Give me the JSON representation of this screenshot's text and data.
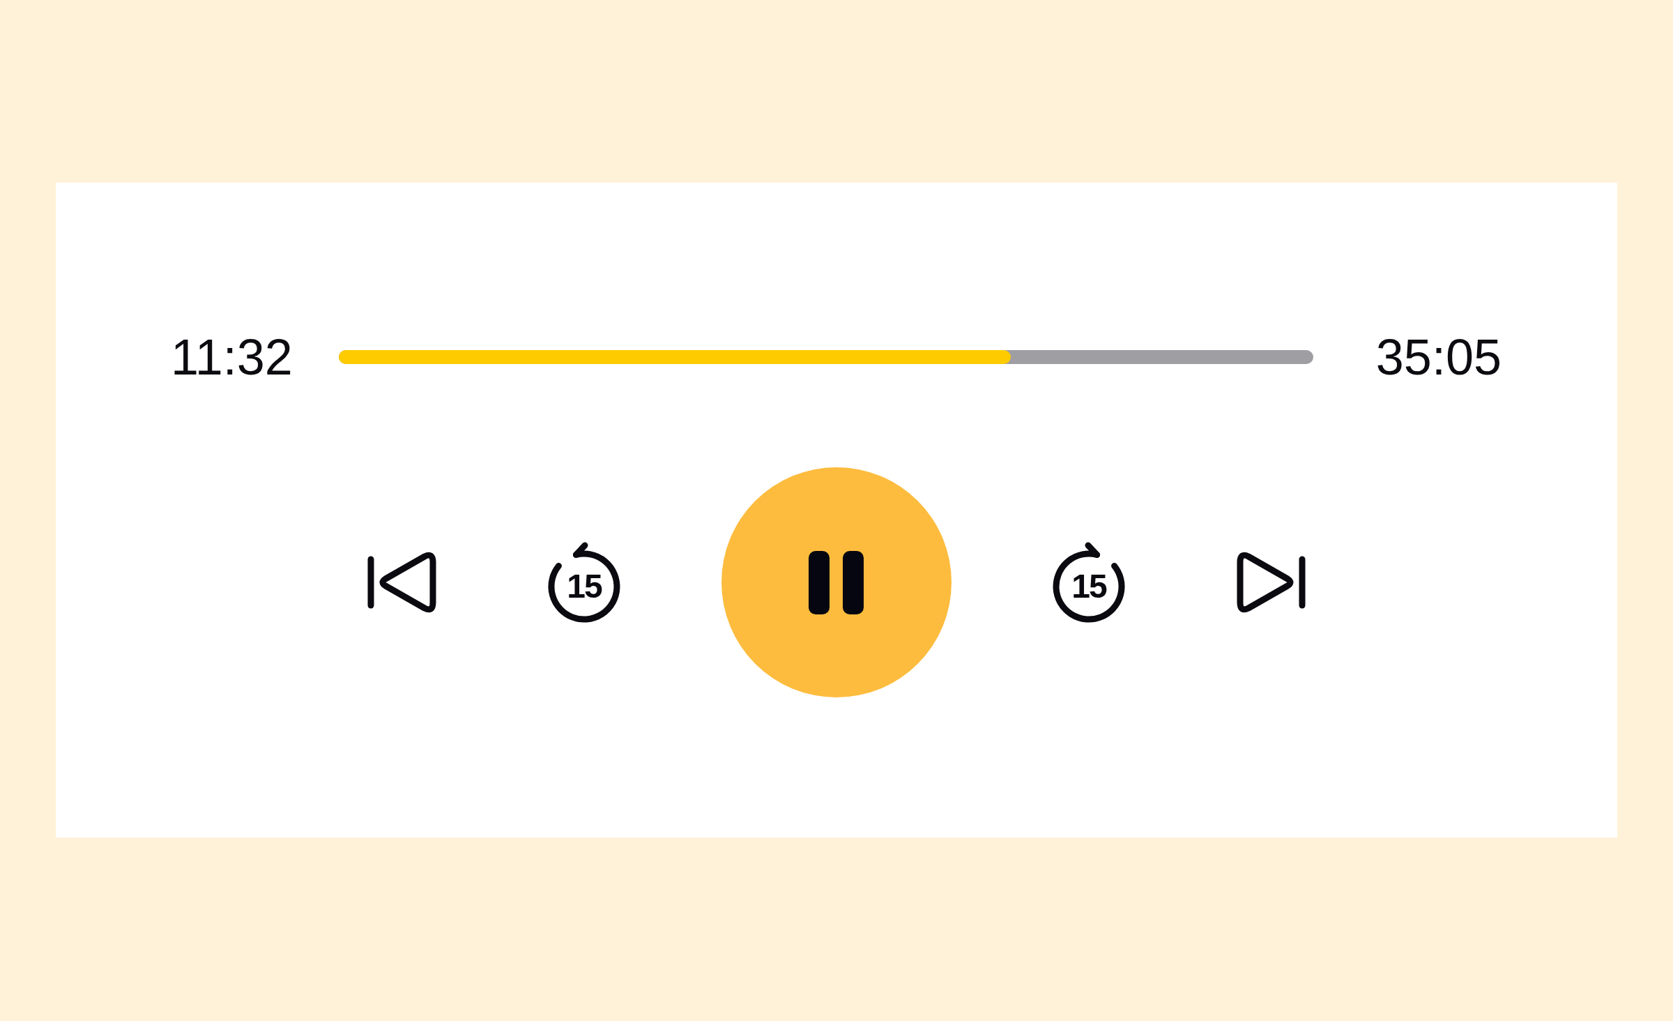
{
  "player": {
    "elapsed": "11:32",
    "duration": "35:05",
    "progress": {
      "level": 0.69
    },
    "playing": true,
    "controls": [
      {
        "kind": "previous"
      },
      {
        "kind": "rewind",
        "label": "15"
      },
      {
        "kind": "play_pause"
      },
      {
        "kind": "forward",
        "label": "15"
      },
      {
        "kind": "next"
      }
    ]
  }
}
